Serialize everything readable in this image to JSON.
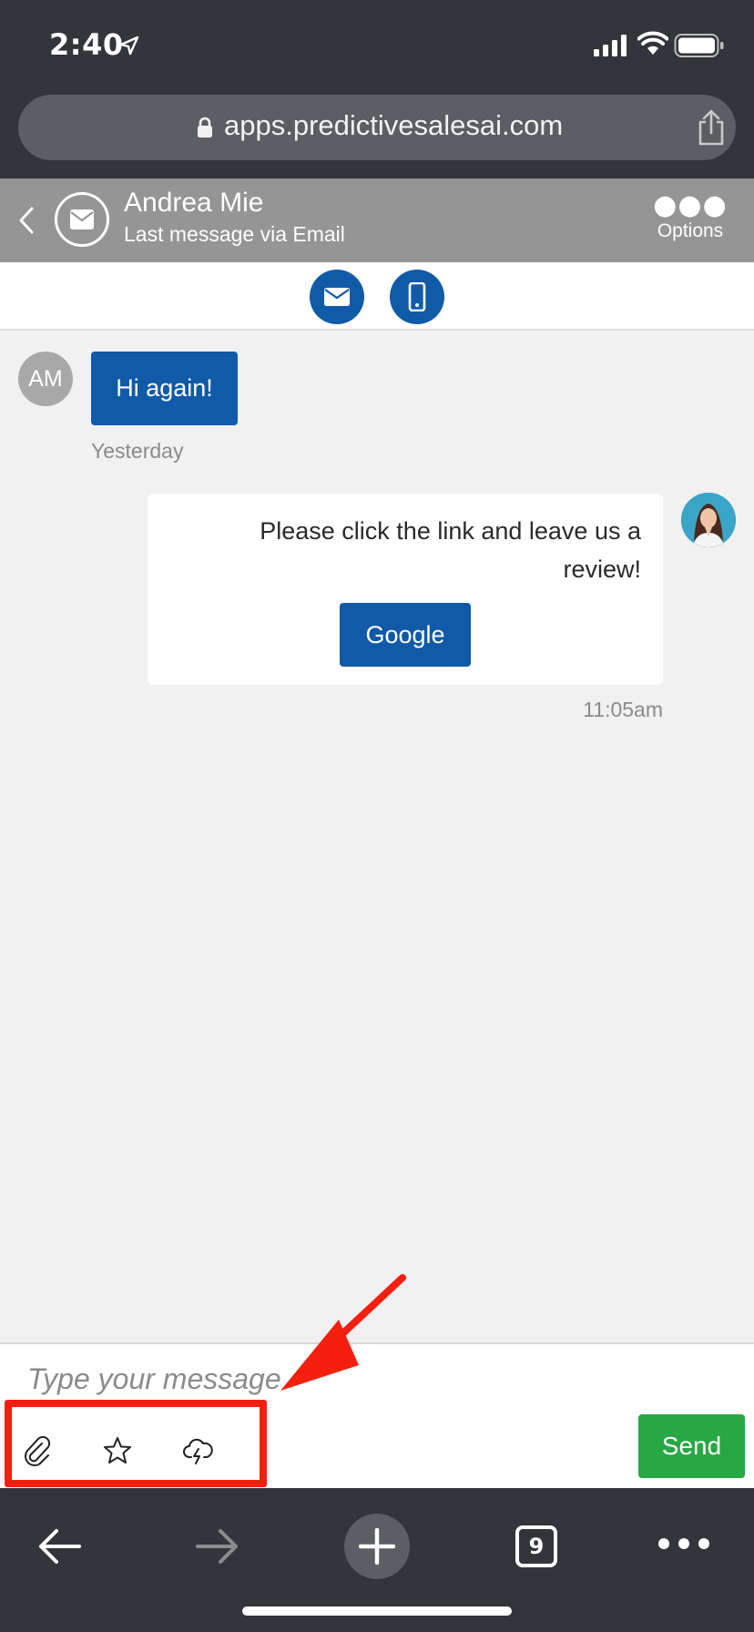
{
  "status_bar": {
    "time": "2:40"
  },
  "browser": {
    "url": "apps.predictivesalesai.com",
    "tab_count": "9"
  },
  "conversation": {
    "contact_name": "Andrea Mie",
    "subtitle": "Last message via Email",
    "options_label": "Options"
  },
  "messages": {
    "incoming": {
      "avatar_initials": "AM",
      "text": "Hi again!",
      "timestamp": "Yesterday"
    },
    "outgoing": {
      "text": "Please click the link and leave us a review!",
      "button_label": "Google",
      "timestamp": "11:05am"
    }
  },
  "composer": {
    "placeholder": "Type your message",
    "send_label": "Send",
    "tools": [
      "paperclip-icon",
      "star-icon",
      "cloud-lightning-icon"
    ]
  },
  "colors": {
    "primary_blue": "#115aa8",
    "send_green": "#28a745",
    "header_gray": "#959595",
    "browser_chrome": "#323539",
    "annotation_red": "#f51f0f"
  }
}
